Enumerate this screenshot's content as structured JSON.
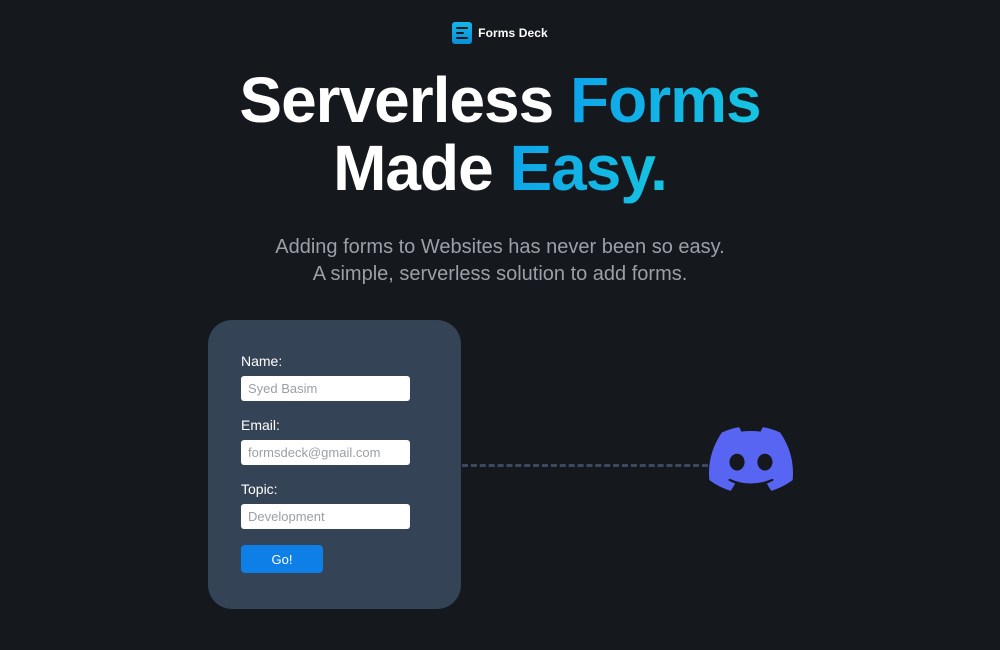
{
  "brand": {
    "name": "Forms Deck",
    "icon": "forms-deck-logo-icon"
  },
  "headline": {
    "line1_plain": "Serverless",
    "line1_accent": "Forms",
    "line2_plain": "Made",
    "line2_accent": "Easy."
  },
  "subtitle": {
    "line1": "Adding forms to Websites has never been so easy.",
    "line2": "A simple, serverless solution to add forms."
  },
  "form": {
    "name_label": "Name:",
    "name_placeholder": "Syed Basim",
    "email_label": "Email:",
    "email_placeholder": "formsdeck@gmail.com",
    "topic_label": "Topic:",
    "topic_placeholder": "Development",
    "submit_label": "Go!"
  },
  "integration": {
    "icon": "discord-icon"
  },
  "colors": {
    "background": "#15181d",
    "accent_start": "#0ea5ea",
    "accent_end": "#16c4e0",
    "card": "#344356",
    "button": "#0f7fe8",
    "discord": "#5865f2",
    "subtitle": "#9aa0a6"
  }
}
